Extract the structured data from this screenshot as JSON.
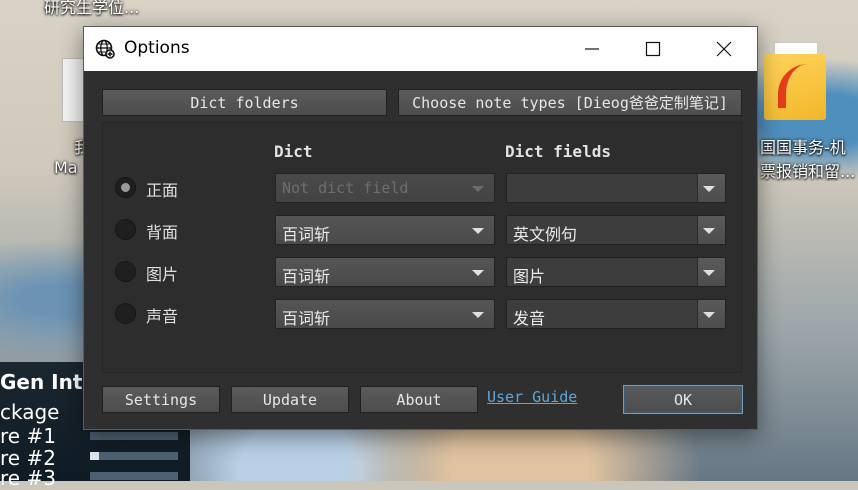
{
  "desktop": {
    "top_label": "研究生学位...",
    "left_label_1": "我",
    "left_label_2": "Ma",
    "right_label_1": "国国事务-机",
    "right_label_2": "票报销和留...",
    "panel": {
      "title": "Gen Int",
      "lines": [
        "ckage",
        "re #1",
        "re #2",
        "re #3"
      ],
      "bars": [
        0.0,
        0.0,
        0.1,
        0.0
      ]
    }
  },
  "window": {
    "title": "Options",
    "icon": "globe-icon",
    "controls": [
      "minimize-icon",
      "maximize-icon",
      "close-icon"
    ]
  },
  "top_buttons": {
    "dict_folders": "Dict folders",
    "choose_note_types": "Choose note types [Dieog爸爸定制笔记]"
  },
  "table": {
    "header_dict": "Dict",
    "header_fields": "Dict fields",
    "rows": [
      {
        "label": "正面",
        "selected": true,
        "dict": "Not dict field",
        "dict_enabled": false,
        "field": ""
      },
      {
        "label": "背面",
        "selected": false,
        "dict": "百词斩",
        "dict_enabled": true,
        "field": "英文例句"
      },
      {
        "label": "图片",
        "selected": false,
        "dict": "百词斩",
        "dict_enabled": true,
        "field": "图片"
      },
      {
        "label": "声音",
        "selected": false,
        "dict": "百词斩",
        "dict_enabled": true,
        "field": "发音"
      }
    ]
  },
  "bottom": {
    "settings": "Settings",
    "update": "Update",
    "about": "About",
    "user_guide": "User Guide",
    "ok": "OK"
  }
}
